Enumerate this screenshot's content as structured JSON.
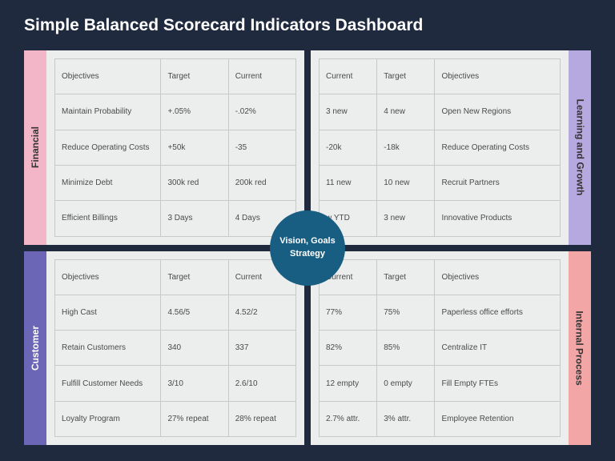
{
  "title": "Simple Balanced Scorecard Indicators Dashboard",
  "center": "Vision, Goals Strategy",
  "quadrants": {
    "financial": {
      "label": "Financial",
      "headers": [
        "Objectives",
        "Target",
        "Current"
      ],
      "rows": [
        [
          "Maintain Probability",
          "+.05%",
          "-.02%"
        ],
        [
          "Reduce Operating Costs",
          "+50k",
          "-35"
        ],
        [
          "Minimize Debt",
          "300k red",
          "200k red"
        ],
        [
          "Efficient Billings",
          "3 Days",
          "4 Days"
        ]
      ]
    },
    "learning": {
      "label": "Learning and Growth",
      "headers": [
        "Current",
        "Target",
        "Objectives"
      ],
      "rows": [
        [
          "3 new",
          "4 new",
          "Open New Regions"
        ],
        [
          "-20k",
          "-18k",
          "Reduce Operating Costs"
        ],
        [
          "11 new",
          "10 new",
          "Recruit Partners"
        ],
        [
          "w YTD",
          "3 new",
          "Innovative Products"
        ]
      ]
    },
    "customer": {
      "label": "Customer",
      "headers": [
        "Objectives",
        "Target",
        "Current"
      ],
      "rows": [
        [
          "High Cast",
          "4.56/5",
          "4.52/2"
        ],
        [
          "Retain Customers",
          "340",
          "337"
        ],
        [
          "Fulfill Customer Needs",
          "3/10",
          "2.6/10"
        ],
        [
          "Loyalty Program",
          "27% repeat",
          "28% repeat"
        ]
      ]
    },
    "internal": {
      "label": "Internal Process",
      "headers": [
        "Current",
        "Target",
        "Objectives"
      ],
      "rows": [
        [
          "77%",
          "75%",
          "Paperless office efforts"
        ],
        [
          "82%",
          "85%",
          "Centralize IT"
        ],
        [
          "12 empty",
          "0 empty",
          "Fill Empty FTEs"
        ],
        [
          "2.7% attr.",
          "3% attr.",
          "Employee Retention"
        ]
      ]
    }
  }
}
